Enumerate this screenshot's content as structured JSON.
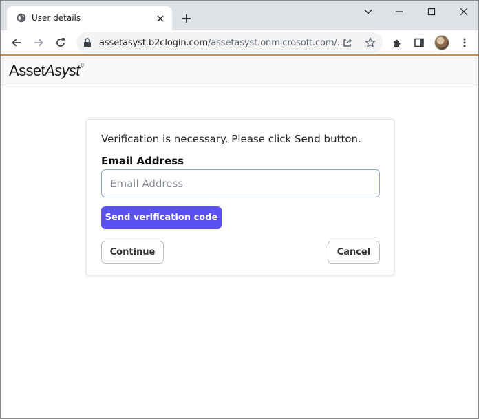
{
  "tab": {
    "title": "User details",
    "icon": "globe-icon"
  },
  "window_controls": [
    "chevron-down-icon",
    "minimize-icon",
    "maximize-icon",
    "close-icon"
  ],
  "toolbar": {
    "url_host": "assetasyst.b2clogin.com",
    "url_path": "/assetasyst.onmicrosoft.com/..."
  },
  "header": {
    "logo_main": "Asset",
    "logo_italic": "Asyst",
    "logo_mark": "®"
  },
  "form": {
    "intro": "Verification is necessary. Please click Send button.",
    "email_label": "Email Address",
    "email_placeholder": "Email Address",
    "email_value": "",
    "send_label": "Send verification code",
    "continue_label": "Continue",
    "cancel_label": "Cancel"
  },
  "colors": {
    "accent": "#5a50f0",
    "header_border": "#e8873a"
  }
}
